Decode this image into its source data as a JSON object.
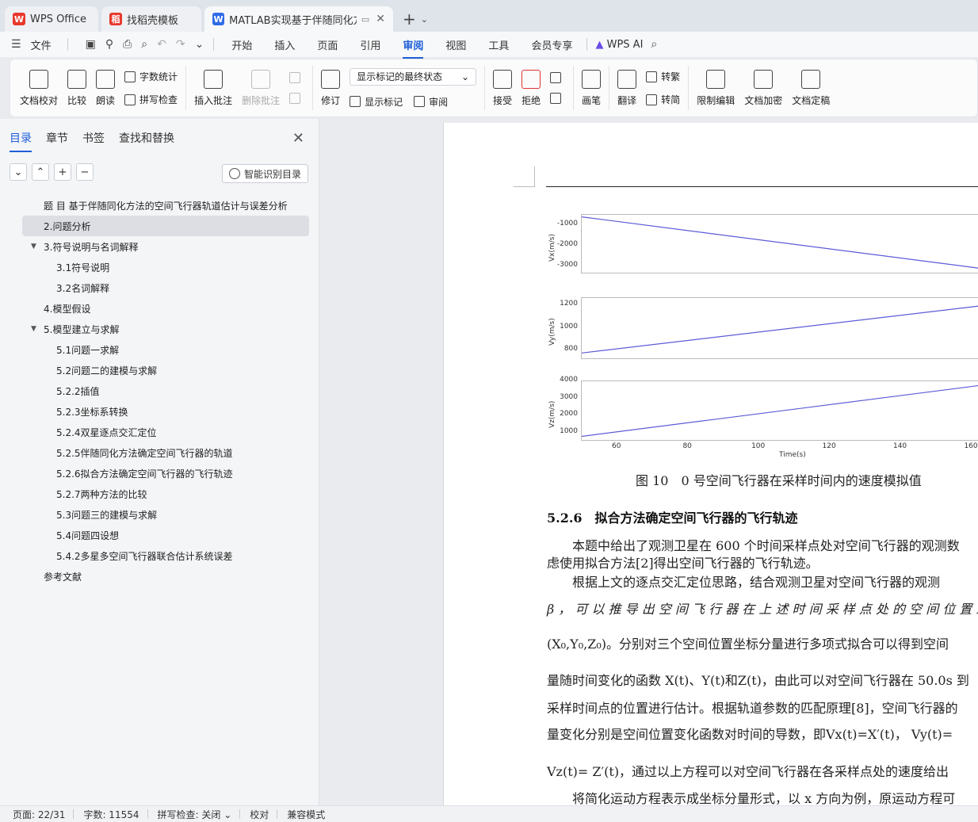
{
  "tabs": [
    {
      "label": "WPS Office",
      "logo": "W",
      "color": "#e8382c"
    },
    {
      "label": "找稻壳模板",
      "logo": "稻",
      "color": "#e8382c"
    },
    {
      "label": "MATLAB实现基于伴随同化方",
      "logo": "W",
      "color": "#2f6be8"
    }
  ],
  "menu": {
    "file": "文件",
    "items": [
      "开始",
      "插入",
      "页面",
      "引用",
      "审阅",
      "视图",
      "工具",
      "会员专享"
    ],
    "active": "审阅",
    "ai": "WPS AI"
  },
  "ribbon": {
    "doc_check": "文档校对",
    "compare": "比较",
    "read": "朗读",
    "word_count": "字数统计",
    "spell_check": "拼写检查",
    "insert_comment": "插入批注",
    "delete_comment": "删除批注",
    "revise": "修订",
    "markup_state": "显示标记的最终状态",
    "show_markup": "显示标记",
    "review": "审阅",
    "accept": "接受",
    "reject": "拒绝",
    "pen": "画笔",
    "translate": "翻译",
    "to_traditional": "转繁",
    "to_simplified": "转简",
    "restrict_edit": "限制编辑",
    "encrypt": "文档加密",
    "finalize": "文档定稿"
  },
  "nav": {
    "tabs": [
      "目录",
      "章节",
      "书签",
      "查找和替换"
    ],
    "smart_toc": "智能识别目录",
    "toc": [
      {
        "label": "题 目 基于伴随同化方法的空间飞行器轨道估计与误差分析",
        "level": 1,
        "tri": false,
        "sel": false
      },
      {
        "label": "2.问题分析",
        "level": 1,
        "tri": false,
        "sel": true
      },
      {
        "label": "3.符号说明与名词解释",
        "level": 1,
        "tri": true,
        "sel": false
      },
      {
        "label": "3.1符号说明",
        "level": 2,
        "tri": false,
        "sel": false
      },
      {
        "label": "3.2名词解释",
        "level": 2,
        "tri": false,
        "sel": false
      },
      {
        "label": "4.模型假设",
        "level": 1,
        "tri": false,
        "sel": false
      },
      {
        "label": "5.模型建立与求解",
        "level": 1,
        "tri": true,
        "sel": false
      },
      {
        "label": "5.1问题一求解",
        "level": 2,
        "tri": false,
        "sel": false
      },
      {
        "label": "5.2问题二的建模与求解",
        "level": 2,
        "tri": false,
        "sel": false
      },
      {
        "label": "5.2.2插值",
        "level": 2,
        "tri": false,
        "sel": false
      },
      {
        "label": "5.2.3坐标系转换",
        "level": 2,
        "tri": false,
        "sel": false
      },
      {
        "label": "5.2.4双星逐点交汇定位",
        "level": 2,
        "tri": false,
        "sel": false
      },
      {
        "label": "5.2.5伴随同化方法确定空间飞行器的轨道",
        "level": 2,
        "tri": false,
        "sel": false
      },
      {
        "label": "5.2.6拟合方法确定空间飞行器的飞行轨迹",
        "level": 2,
        "tri": false,
        "sel": false
      },
      {
        "label": "5.2.7两种方法的比较",
        "level": 2,
        "tri": false,
        "sel": false
      },
      {
        "label": "5.3问题三的建模与求解",
        "level": 2,
        "tri": false,
        "sel": false
      },
      {
        "label": "5.4问题四设想",
        "level": 2,
        "tri": false,
        "sel": false
      },
      {
        "label": "5.4.2多星多空间飞行器联合估计系统误差",
        "level": 2,
        "tri": false,
        "sel": false
      },
      {
        "label": "参考文献",
        "level": 1,
        "tri": false,
        "sel": false
      }
    ]
  },
  "chart_data": {
    "type": "line",
    "xlabel": "Time(s)",
    "x_ticks": [
      60,
      80,
      100,
      120,
      140,
      160
    ],
    "xlim": [
      50,
      162
    ],
    "series": [
      {
        "ylabel": "Vx(m/s)",
        "y_ticks": [
          -1000,
          -2000,
          -3000
        ],
        "ylim": [
          -3400,
          -500
        ],
        "x": [
          50,
          162
        ],
        "y": [
          -600,
          -3100
        ],
        "color": "#5b5bd6"
      },
      {
        "ylabel": "Vy(m/s)",
        "y_ticks": [
          1200,
          1000,
          800
        ],
        "ylim": [
          720,
          1260
        ],
        "x": [
          50,
          162
        ],
        "y": [
          780,
          1190
        ],
        "color": "#5b5bd6"
      },
      {
        "ylabel": "Vz(m/s)",
        "y_ticks": [
          4000,
          3000,
          2000,
          1000
        ],
        "ylim": [
          500,
          4000
        ],
        "x": [
          50,
          162
        ],
        "y": [
          800,
          3750
        ],
        "color": "#5b5bd6"
      }
    ]
  },
  "doc": {
    "caption": "图 10　0 号空间飞行器在采样时间内的速度模拟值",
    "heading": "5.2.6　拟合方法确定空间飞行器的飞行轨迹",
    "lines": [
      "　　本题中给出了观测卫星在 600 个时间采样点处对空间飞行器的观测数",
      "虑使用拟合方法[2]得出空间飞行器的飞行轨迹。",
      "　　根据上文的逐点交汇定位思路，结合观测卫星对空间飞行器的观测",
      "β ， 可 以 推 导 出 空 间 飞 行 器 在 上 述 时 间 采 样 点 处 的 空 间 位 置 观",
      "(X₀,Y₀,Z₀)。分别对三个空间位置坐标分量进行多项式拟合可以得到空间",
      "量随时间变化的函数 X(t)、Y(t)和Z(t)，由此可以对空间飞行器在 50.0s 到",
      "采样时间点的位置进行估计。根据轨道参数的匹配原理[8]，空间飞行器的",
      "量变化分别是空间位置变化函数对时间的导数，即Vx(t)=X′(t)， Vy(t)=",
      "Vz(t)= Z′(t)，通过以上方程可以对空间飞行器在各采样点处的速度给出",
      "　　将简化运动方程表示成坐标分量形式，以 x 方向为例，原运动方程可"
    ]
  },
  "status": {
    "page": "页面: 22/31",
    "words": "字数: 11554",
    "spell": "拼写检查: 关闭",
    "proof": "校对",
    "compat": "兼容模式"
  }
}
